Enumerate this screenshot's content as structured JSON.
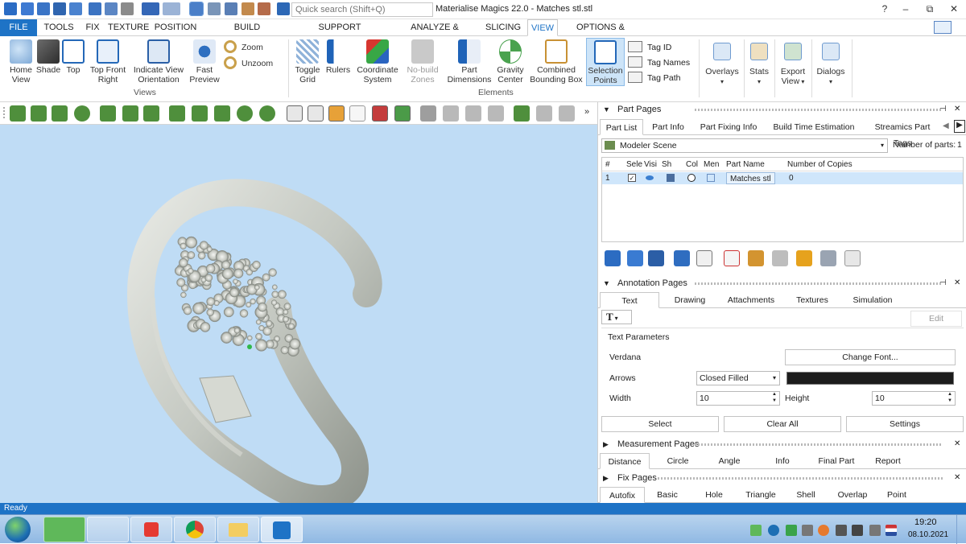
{
  "window": {
    "search_placeholder": "Quick search (Shift+Q)",
    "title": "Materialise Magics 22.0 - Matches stl.stl",
    "controls": [
      "?",
      "–",
      "⧉",
      "✕"
    ]
  },
  "menu": {
    "tabs": [
      "FILE",
      "TOOLS",
      "FIX",
      "TEXTURE",
      "POSITION",
      "BUILD PREPARATION",
      "SUPPORT GENERATION",
      "ANALYZE & REPORT",
      "SLICING",
      "VIEW",
      "OPTIONS & HELP"
    ],
    "active": "VIEW"
  },
  "ribbon": {
    "views": {
      "home_view": [
        "Home",
        "View"
      ],
      "shade": "Shade",
      "top": "Top",
      "top_front_right": [
        "Top Front",
        "Right"
      ],
      "indicate_view": [
        "Indicate View",
        "Orientation"
      ],
      "fast_preview": [
        "Fast",
        "Preview"
      ],
      "zoom": "Zoom",
      "unzoom": "Unzoom",
      "group_label": "Views"
    },
    "elements": {
      "toggle_grid": [
        "Toggle",
        "Grid"
      ],
      "rulers": "Rulers",
      "coordinate_system": [
        "Coordinate",
        "System"
      ],
      "no_build_zones": [
        "No-build",
        "Zones"
      ],
      "part_dimensions": [
        "Part",
        "Dimensions"
      ],
      "gravity_center": [
        "Gravity",
        "Center"
      ],
      "combined_bbox": [
        "Combined",
        "Bounding Box"
      ],
      "selection_points": [
        "Selection",
        "Points"
      ],
      "tag_id": "Tag ID",
      "tag_names": "Tag Names",
      "tag_path": "Tag Path",
      "group_label": "Elements"
    },
    "right": {
      "overlays": "Overlays",
      "stats": "Stats",
      "export": "Export",
      "export_view": "View",
      "dialogs": "Dialogs"
    }
  },
  "part_pages": {
    "title": "Part Pages",
    "tabs": [
      "Part List",
      "Part Info",
      "Part Fixing Info",
      "Build Time Estimation",
      "Streamics Part Tags"
    ],
    "active_tab": "Part List",
    "scene": "Modeler Scene",
    "parts_label": "Number of parts:",
    "parts_count": "1",
    "columns": [
      "#",
      "Sele",
      "Visi",
      "Sh",
      "Col",
      "Men",
      "Part Name",
      "Number of Copies"
    ],
    "rows": [
      {
        "num": "1",
        "name": "Matches stl",
        "copies": "0"
      }
    ]
  },
  "annotation_pages": {
    "title": "Annotation Pages",
    "tabs": [
      "Text",
      "Drawing",
      "Attachments",
      "Textures",
      "Simulation"
    ],
    "active_tab": "Text",
    "text_tool": "T",
    "edit": "Edit",
    "params_title": "Text Parameters",
    "font_name": "Verdana",
    "change_font": "Change Font...",
    "arrows_label": "Arrows",
    "arrows_value": "Closed Filled",
    "width_label": "Width",
    "width_value": "10",
    "height_label": "Height",
    "height_value": "10",
    "buttons": [
      "Select",
      "Clear All",
      "Settings"
    ]
  },
  "measurement_pages": {
    "title": "Measurement Pages",
    "tabs": [
      "Distance",
      "Circle",
      "Angle",
      "Info",
      "Final Part",
      "Report"
    ],
    "active_tab": "Distance"
  },
  "fix_pages": {
    "title": "Fix Pages",
    "tabs": [
      "Autofix",
      "Basic",
      "Hole",
      "Triangle",
      "Shell",
      "Overlap",
      "Point"
    ],
    "active_tab": "Autofix"
  },
  "status": "Ready",
  "taskbar": {
    "start": "start-orb",
    "apps": [
      "magics",
      "yu-app",
      "yandex",
      "chrome",
      "explorer",
      "materialise"
    ],
    "time": "19:20",
    "date": "08.10.2021"
  },
  "colors": {
    "accent": "#1e73c6",
    "viewport": "#bfdcf5",
    "model": "#c9ccc6"
  }
}
